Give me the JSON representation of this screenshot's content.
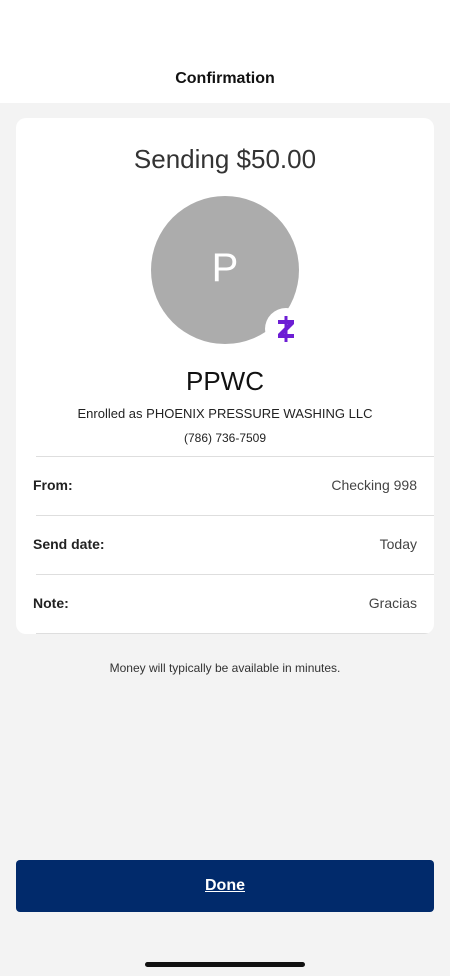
{
  "header": {
    "title": "Confirmation"
  },
  "summary": {
    "sending_text": "Sending $50.00",
    "avatar_letter": "P",
    "payee_name": "PPWC",
    "enrolled_text": "Enrolled as PHOENIX PRESSURE WASHING LLC",
    "phone": "(786) 736-7509"
  },
  "details": [
    {
      "label": "From:",
      "value": "Checking 998"
    },
    {
      "label": "Send date:",
      "value": "Today"
    },
    {
      "label": "Note:",
      "value": "Gracias"
    }
  ],
  "info_note": "Money will typically be available in minutes.",
  "actions": {
    "done_label": "Done"
  },
  "colors": {
    "primary": "#012a6b",
    "zelle_purple": "#6d1ed4",
    "avatar_gray": "#acacac"
  },
  "icons": {
    "badge": "zelle-logo-icon"
  }
}
